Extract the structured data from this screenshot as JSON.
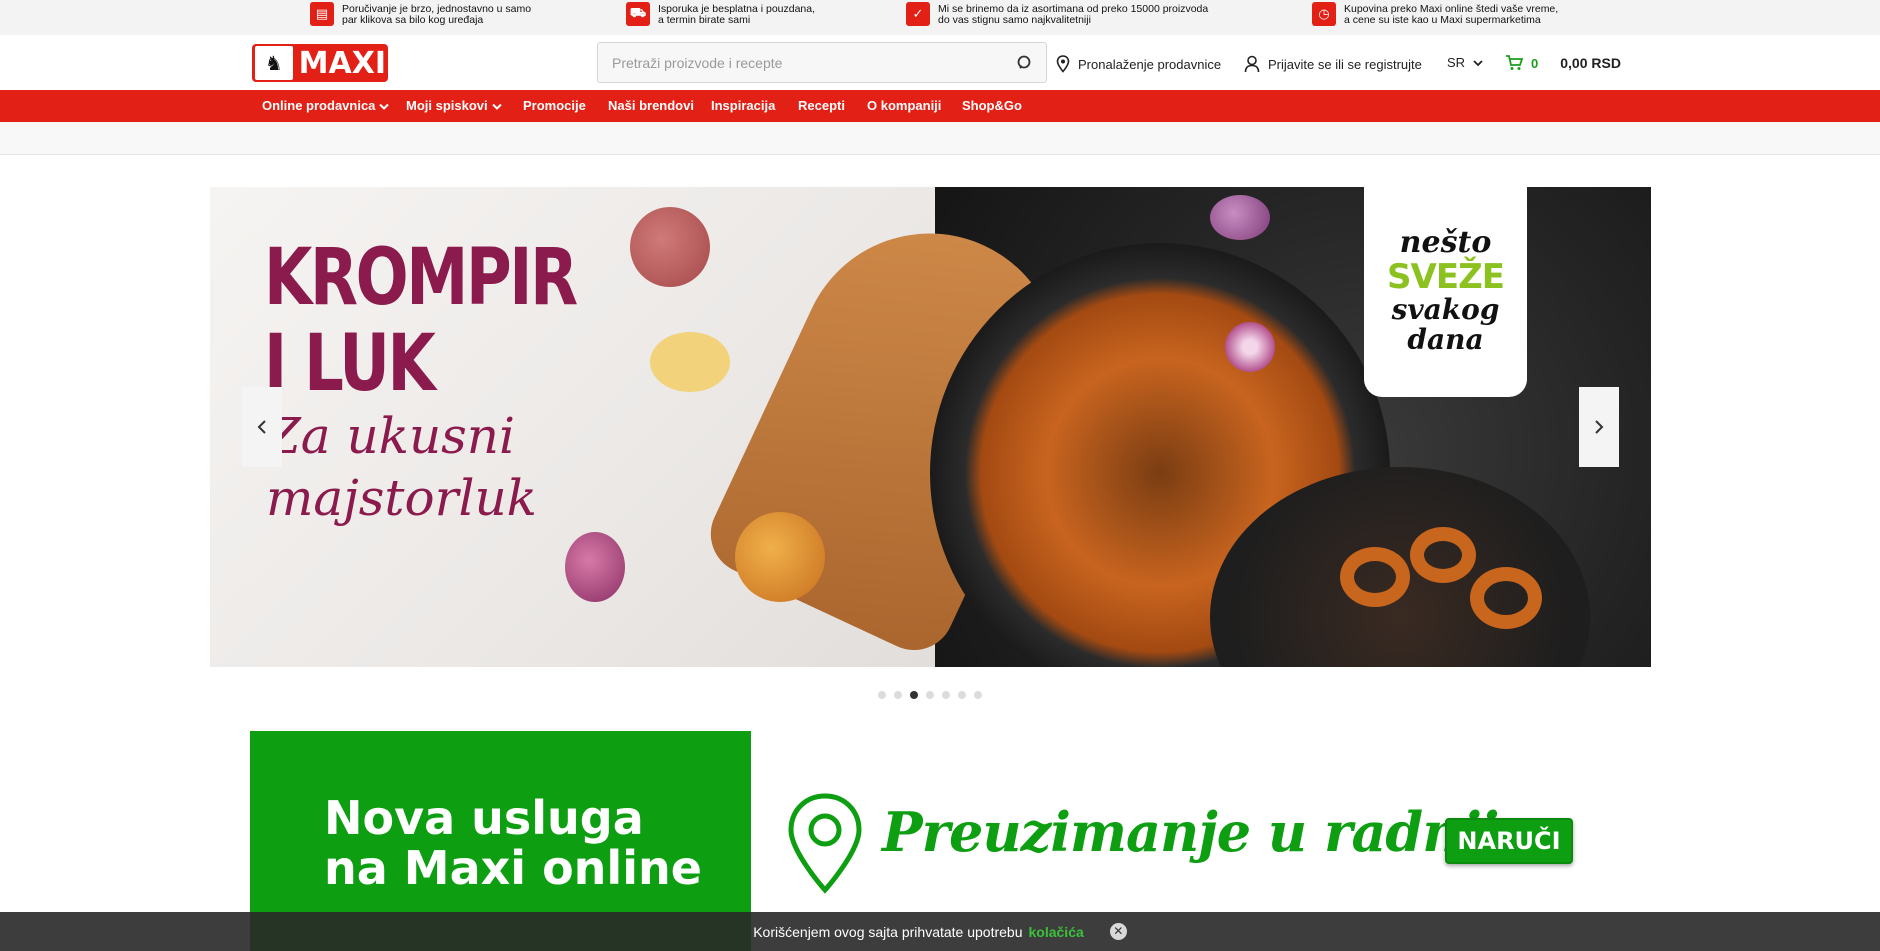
{
  "topbar": {
    "items": [
      {
        "icon": "computer-order-icon",
        "text": "Poručivanje je brzo, jednostavno u samo\npar klikova sa bilo kog uređaja"
      },
      {
        "icon": "delivery-truck-icon",
        "text": "Isporuka je besplatna i pouzdana,\na termin birate sami"
      },
      {
        "icon": "quality-scooter-icon",
        "text": "Mi se brinemo da iz asortimana od preko 15000 proizvoda\ndo vas stignu samo najkvalitetniji"
      },
      {
        "icon": "clock-price-icon",
        "text": "Kupovina preko Maxi online štedi vaše vreme,\na cene su iste kao u Maxi supermarketima"
      }
    ]
  },
  "header": {
    "logo_text": "MAXI",
    "search_placeholder": "Pretraži proizvode i recepte",
    "store_finder": "Pronalaženje prodavnice",
    "login": "Prijavite se ili se registrujte",
    "language": "SR",
    "cart_count": "0",
    "cart_total": "0,00 RSD"
  },
  "nav": {
    "items": [
      {
        "label": "Online prodavnica",
        "dropdown": true
      },
      {
        "label": "Moji spiskovi",
        "dropdown": true
      },
      {
        "label": "Promocije",
        "dropdown": false
      },
      {
        "label": "Naši brendovi",
        "dropdown": false
      },
      {
        "label": "Inspiracija",
        "dropdown": false
      },
      {
        "label": "Recepti",
        "dropdown": false
      },
      {
        "label": "O kompaniji",
        "dropdown": false
      },
      {
        "label": "Shop&Go",
        "dropdown": false
      }
    ]
  },
  "hero": {
    "title": "KROMPIR\nI LUK",
    "script": "Za ukusni\nmajstorluk",
    "badge_line1": "nešto",
    "badge_line2": "SVEŽE",
    "badge_line3": "svakog\ndana",
    "slide_count": 7,
    "active_slide": 2
  },
  "promo": {
    "title": "Nova usluga\nna Maxi online",
    "script": "Preuzimanje u radnji",
    "button": "NARUČI"
  },
  "cookie": {
    "text": "Korišćenjem ovog sajta prihvatate upotrebu",
    "link": "kolačića"
  },
  "colors": {
    "brand_red": "#e32016",
    "brand_green": "#0d9e11",
    "hero_purple": "#8b1a4d",
    "fresh_green": "#8cc21f"
  }
}
